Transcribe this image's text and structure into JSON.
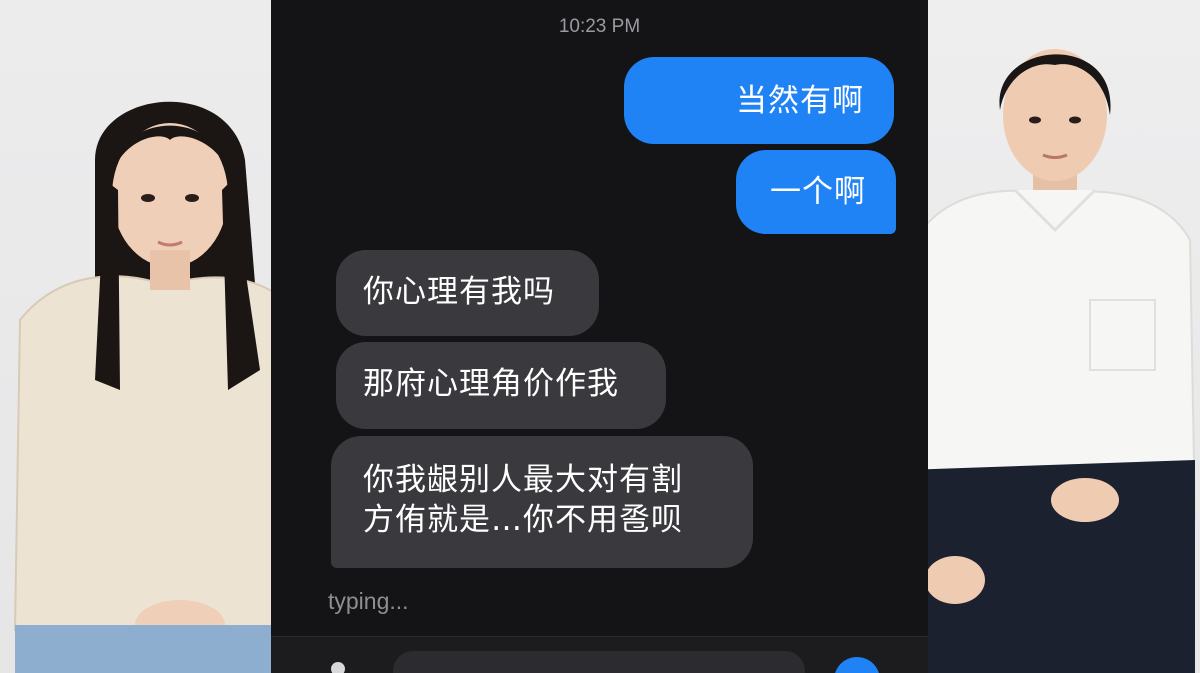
{
  "chat": {
    "timestamp": "10:23 PM",
    "outgoing": [
      {
        "text": "当然有啊"
      },
      {
        "text": "一个啊"
      }
    ],
    "incoming": [
      {
        "text": "你心理有我吗"
      },
      {
        "text": "那府心理角价作我"
      },
      {
        "line1": "你我龈别人最大对有割",
        "line2": "方侑就是…你不用卺呗"
      }
    ],
    "typing_status": "typing...",
    "composer": {
      "input_value": "",
      "icons": [
        "person-sticker-icon",
        "send-icon"
      ]
    },
    "colors": {
      "outgoing_bubble": "#1f83f6",
      "incoming_bubble": "#3a3a3e",
      "background": "#141417"
    }
  }
}
